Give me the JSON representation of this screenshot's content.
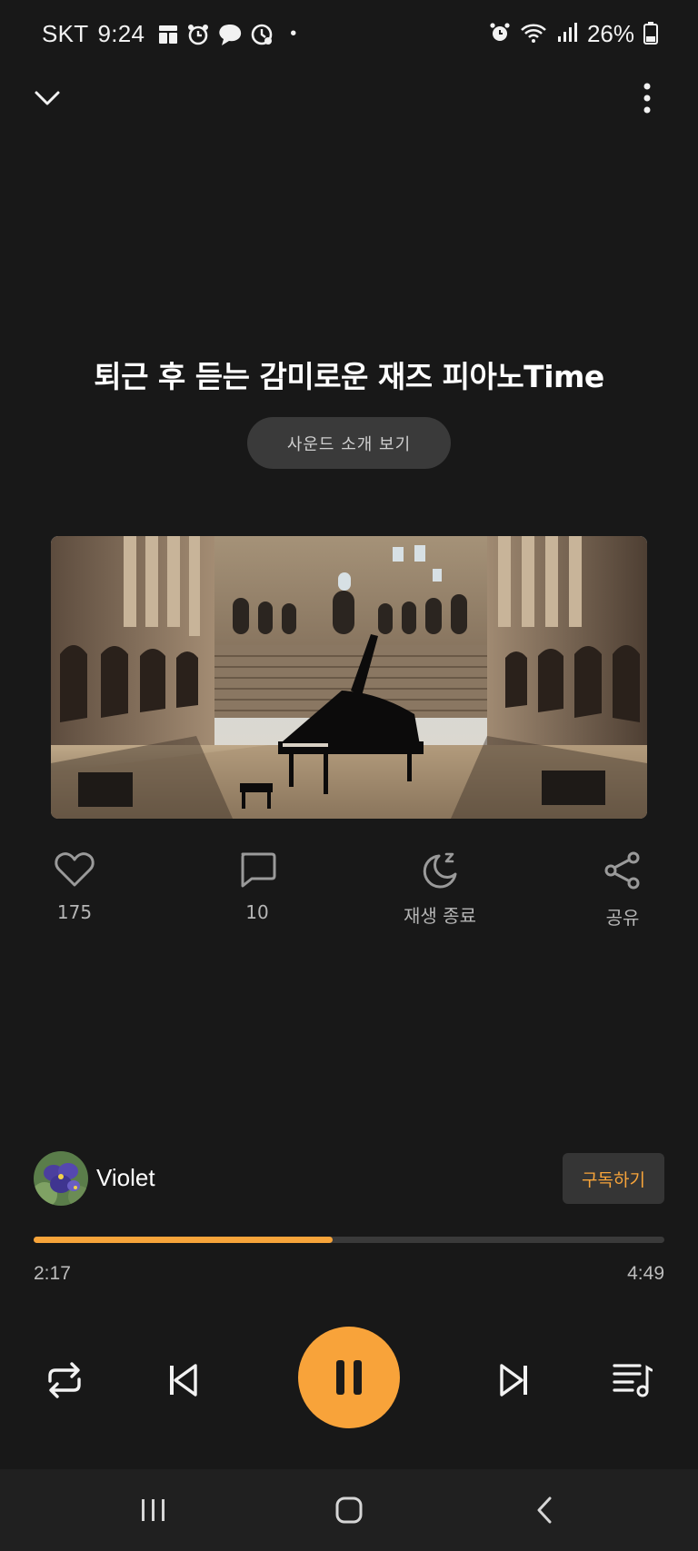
{
  "status_bar": {
    "carrier": "SKT",
    "time": "9:24",
    "dot": "•",
    "battery_percent": "26%",
    "icons_left": [
      "grid-app-icon",
      "alarm-app-icon",
      "chat-app-icon",
      "clock-app-icon"
    ],
    "icons_right": [
      "alarm-icon",
      "wifi-icon",
      "signal-icon",
      "battery-icon"
    ]
  },
  "top_bar": {
    "collapse_icon": "chevron-down-icon",
    "more_icon": "more-vertical-icon"
  },
  "track": {
    "title": "퇴근 후 듣는 감미로운 재즈 피아노Time",
    "intro_button": "사운드 소개 보기",
    "artwork": "grand piano in an ancient colosseum ruin"
  },
  "actions": [
    {
      "icon": "heart-icon",
      "label": "175"
    },
    {
      "icon": "comment-icon",
      "label": "10"
    },
    {
      "icon": "sleep-timer-icon",
      "label": "재생 종료"
    },
    {
      "icon": "share-icon",
      "label": "공유"
    }
  ],
  "artist": {
    "name": "Violet",
    "subscribe_label": "구독하기"
  },
  "playback": {
    "elapsed": "2:17",
    "total": "4:49",
    "progress_fraction": 0.474
  },
  "controls": {
    "repeat_icon": "repeat-icon",
    "previous_icon": "skip-previous-icon",
    "pause_icon": "pause-icon",
    "next_icon": "skip-next-icon",
    "queue_icon": "playlist-icon"
  },
  "nav_bar": {
    "recents_icon": "recents-icon",
    "home_icon": "home-icon",
    "back_icon": "back-icon"
  },
  "colors": {
    "background": "#181818",
    "accent": "#f7a43a",
    "muted_text": "#b5b5b5"
  }
}
